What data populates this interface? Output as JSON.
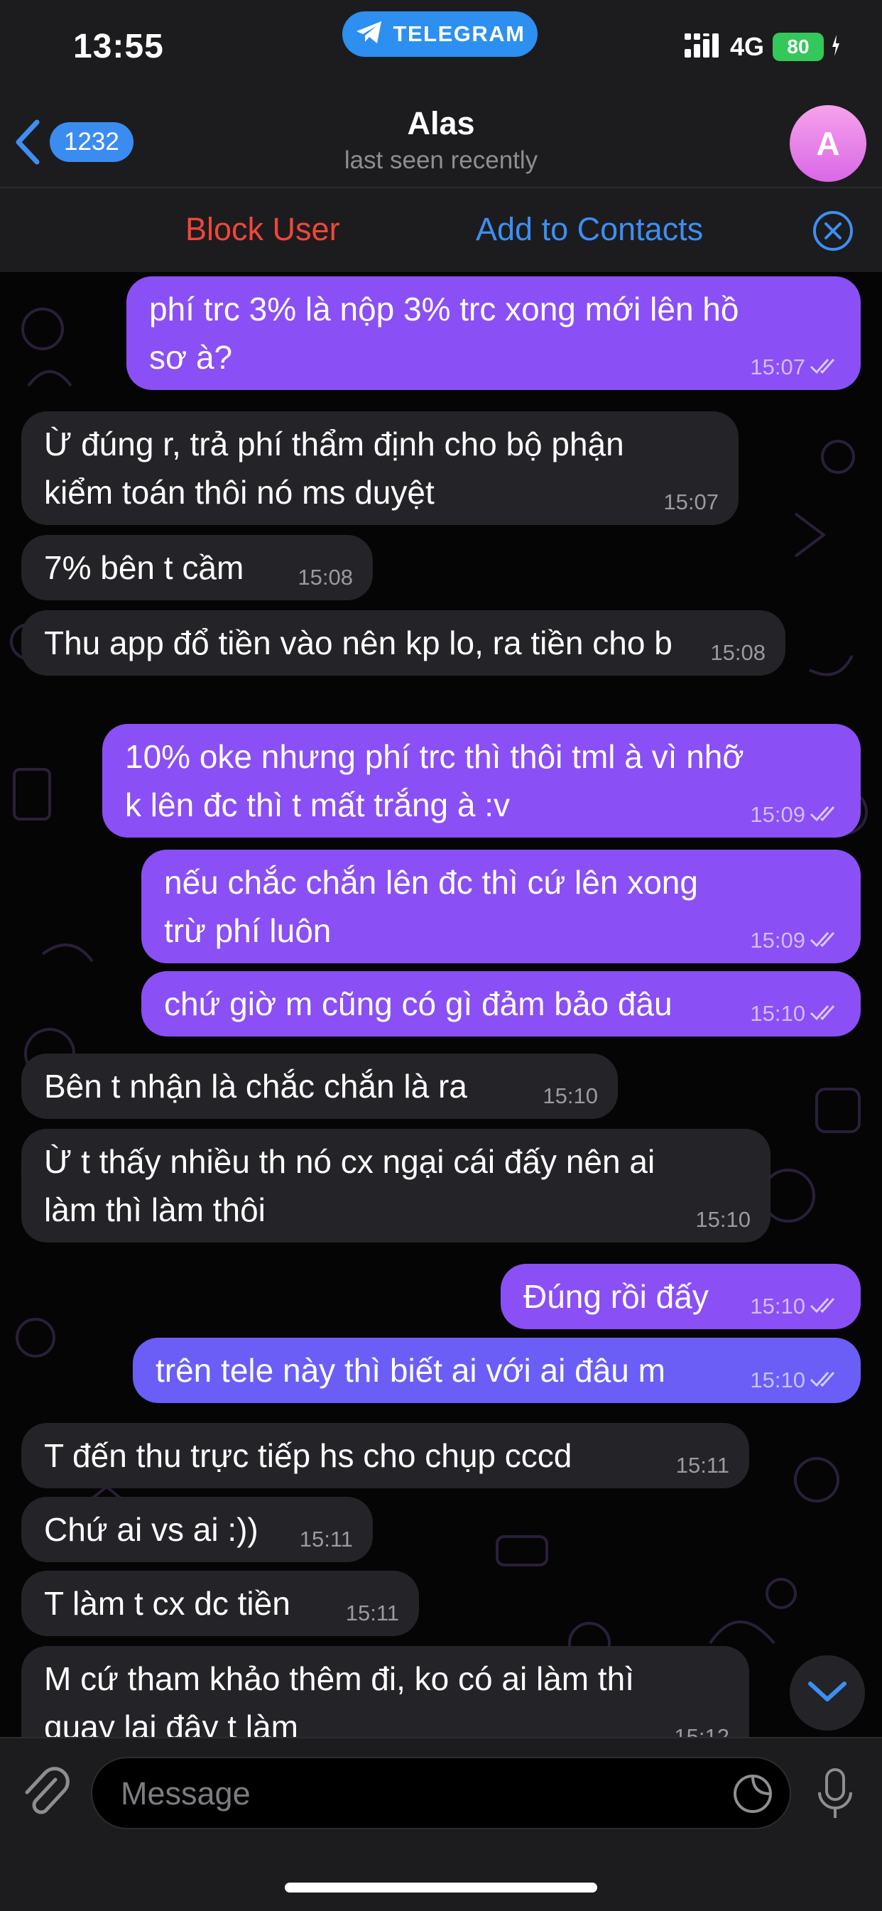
{
  "status_bar": {
    "time": "13:55",
    "app_pill": "TELEGRAM",
    "network": "4G",
    "battery": "80"
  },
  "header": {
    "back_count": "1232",
    "title": "Alas",
    "subtitle": "last seen recently",
    "avatar_letter": "A"
  },
  "actions": {
    "block": "Block User",
    "add_contact": "Add to Contacts"
  },
  "messages": [
    {
      "dir": "out",
      "text": "phí trc 3% là nộp 3% trc xong mới lên hồ sơ à?",
      "time": "15:07",
      "status": "read"
    },
    {
      "dir": "in",
      "text": "Ừ đúng r, trả phí thẩm định cho bộ phận kiểm toán thôi nó ms duyệt",
      "time": "15:07"
    },
    {
      "dir": "in",
      "text": "7% bên t cầm",
      "time": "15:08"
    },
    {
      "dir": "in",
      "text": "Thu app đổ tiền vào nên kp lo, ra tiền cho b",
      "time": "15:08"
    },
    {
      "dir": "out",
      "text": "10% oke nhưng phí trc thì thôi tml à vì nhỡ k lên đc thì t mất trắng à :v",
      "time": "15:09",
      "status": "read"
    },
    {
      "dir": "out",
      "text": "nếu chắc chắn lên đc thì cứ lên xong trừ phí luôn",
      "time": "15:09",
      "status": "read"
    },
    {
      "dir": "out",
      "text": "chứ giờ m cũng có gì đảm bảo đâu",
      "time": "15:10",
      "status": "read"
    },
    {
      "dir": "in",
      "text": "Bên t nhận là chắc chắn là ra",
      "time": "15:10"
    },
    {
      "dir": "in",
      "text": "Ừ t thấy nhiều th nó cx ngại cái đấy nên ai làm thì làm thôi",
      "time": "15:10"
    },
    {
      "dir": "out",
      "text": "Đúng rồi đấy",
      "time": "15:10",
      "status": "read"
    },
    {
      "dir": "out",
      "text": "trên tele này thì biết ai với ai đâu m",
      "time": "15:10",
      "status": "read"
    },
    {
      "dir": "in",
      "text": "T đến thu trực tiếp hs cho chụp cccd",
      "time": "15:11"
    },
    {
      "dir": "in",
      "text": "Chứ ai vs ai :))",
      "time": "15:11"
    },
    {
      "dir": "in",
      "text": "T làm t cx dc tiền",
      "time": "15:11"
    },
    {
      "dir": "in",
      "text": "M cứ tham khảo thêm đi, ko có ai làm thì quay lại đây t làm",
      "time": "15:12"
    }
  ],
  "composer": {
    "placeholder": "Message"
  },
  "icons": {
    "back": "chevron-left-icon",
    "telegram": "paper-plane-icon",
    "close": "close-circle-icon",
    "attach": "paperclip-icon",
    "sticker": "sticker-icon",
    "mic": "microphone-icon",
    "scroll_down": "chevron-down-icon"
  },
  "colors": {
    "accent": "#3d8ff2",
    "block": "#f0463c",
    "outgoing_bubble": "#8a4ff5",
    "incoming_bubble": "#242428",
    "avatar": "#e07be8"
  }
}
